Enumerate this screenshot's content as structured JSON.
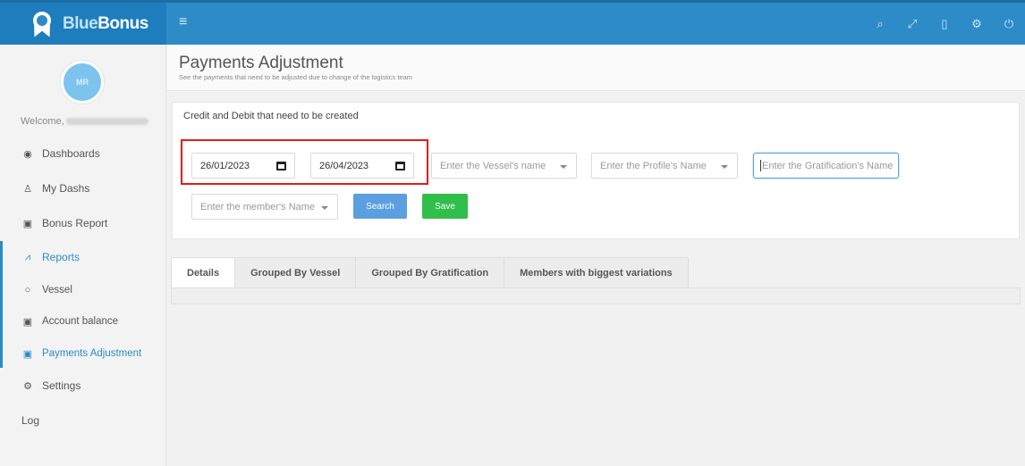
{
  "brand": {
    "name_part1": "Blue",
    "name_part2": "Bonus",
    "avatar_initials": "MR"
  },
  "topbar": {
    "menu_icon": "hamburger-icon",
    "icons": [
      "search-icon",
      "expand-icon",
      "mobile-icon",
      "cogs-icon",
      "power-icon"
    ]
  },
  "sidebar": {
    "welcome": "Welcome,",
    "items": [
      {
        "label": "Dashboards",
        "icon": "tachometer-icon"
      },
      {
        "label": "My Dashs",
        "icon": "user-icon"
      },
      {
        "label": "Bonus Report",
        "icon": "money-icon"
      },
      {
        "label": "Reports",
        "icon": "line-chart-icon"
      },
      {
        "label": "Vessel",
        "icon": "circle-icon"
      },
      {
        "label": "Account balance",
        "icon": "money-icon"
      },
      {
        "label": "Payments Adjustment",
        "icon": "money-icon"
      },
      {
        "label": "Settings",
        "icon": "cogs-icon"
      },
      {
        "label": "Log",
        "icon": ""
      }
    ]
  },
  "page": {
    "title": "Payments Adjustment",
    "subtitle": "See the payments that need to be adjusted due to change of the logistics team"
  },
  "filters": {
    "section_title": "Credit and Debit that need to be created",
    "date_from": "26/01/2023",
    "date_to": "26/04/2023",
    "vessel_placeholder": "Enter the Vessel's name",
    "profile_placeholder": "Enter the Profile's Name",
    "gratification_placeholder": "Enter the Gratification's Name",
    "member_placeholder": "Enter the member's Name",
    "search_label": "Search",
    "save_label": "Save"
  },
  "tabs": [
    {
      "label": "Details",
      "active": true
    },
    {
      "label": "Grouped By Vessel",
      "active": false
    },
    {
      "label": "Grouped By Gratification",
      "active": false
    },
    {
      "label": "Members with biggest variations",
      "active": false
    }
  ],
  "colors": {
    "brand": "#2d8bc8",
    "highlight": "#e21c1c",
    "search_button": "#5b9fe0",
    "save_button": "#2fbf4a"
  }
}
